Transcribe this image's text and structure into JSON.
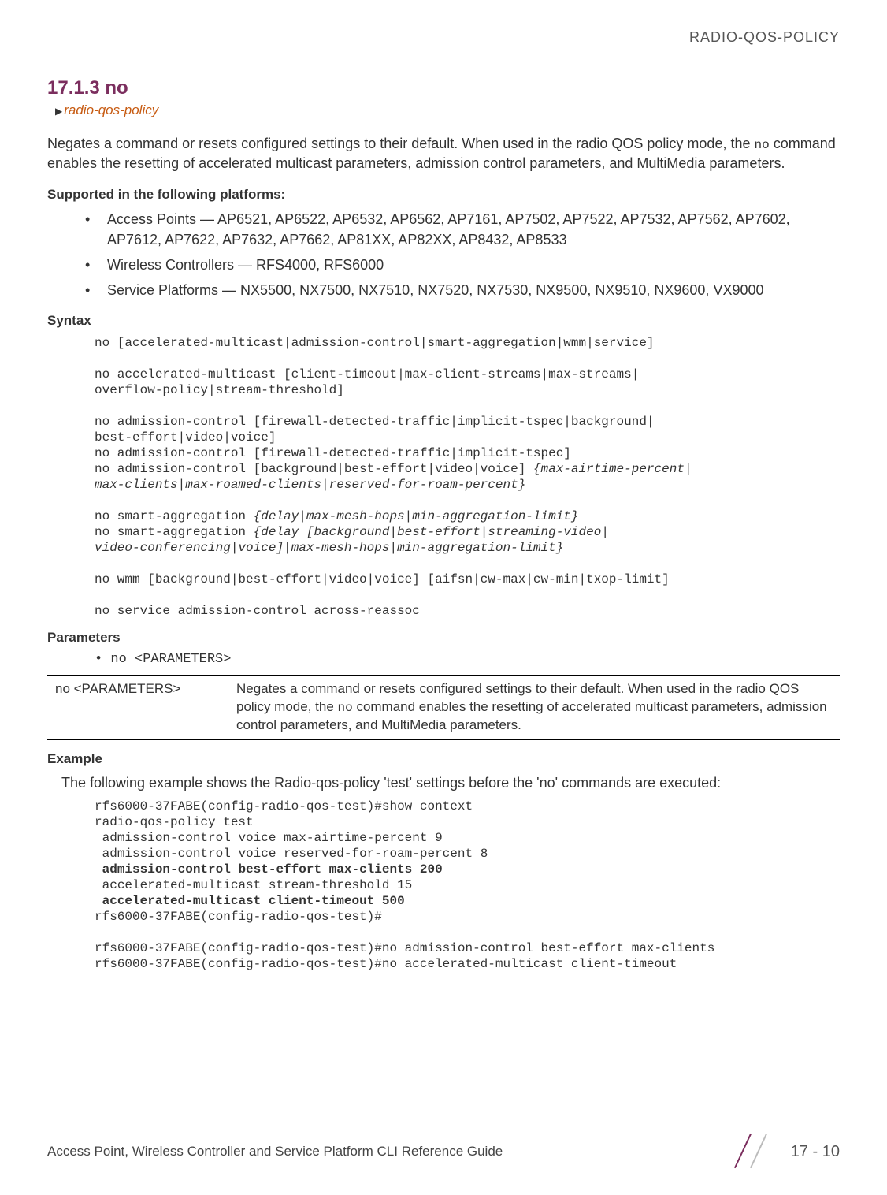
{
  "header": {
    "title": "RADIO-QOS-POLICY"
  },
  "section": {
    "number_title": "17.1.3 no",
    "breadcrumb": "radio-qos-policy"
  },
  "intro": {
    "part1": "Negates a command or resets configured settings to their default. When used in the radio QOS policy mode, the ",
    "mono": "no",
    "part2": " command enables the resetting of accelerated multicast parameters, admission control parameters, and MultiMedia parameters."
  },
  "platforms_label": "Supported in the following platforms:",
  "platforms": [
    "Access Points — AP6521, AP6522, AP6532, AP6562, AP7161, AP7502, AP7522, AP7532, AP7562, AP7602, AP7612, AP7622, AP7632, AP7662, AP81XX, AP82XX, AP8432, AP8533",
    "Wireless Controllers — RFS4000, RFS6000",
    "Service Platforms — NX5500, NX7500, NX7510, NX7520, NX7530, NX9500, NX9510, NX9600, VX9000"
  ],
  "syntax_label": "Syntax",
  "syntax": {
    "l1": "no [accelerated-multicast|admission-control|smart-aggregation|wmm|service]",
    "l2": "no accelerated-multicast [client-timeout|max-client-streams|max-streams|\noverflow-policy|stream-threshold]",
    "l3": "no admission-control [firewall-detected-traffic|implicit-tspec|background|\nbest-effort|video|voice]",
    "l4": "no admission-control [firewall-detected-traffic|implicit-tspec]",
    "l5a": "no admission-control [background|best-effort|video|voice] ",
    "l5b": "{max-airtime-percent|\nmax-clients|max-roamed-clients|reserved-for-roam-percent}",
    "l6a": "no smart-aggregation ",
    "l6b": "{delay|max-mesh-hops|min-aggregation-limit}",
    "l7a": "no smart-aggregation ",
    "l7b": "{delay [background|best-effort|streaming-video|\nvideo-conferencing|voice]|max-mesh-hops|min-aggregation-limit}",
    "l8": "no wmm [background|best-effort|video|voice] [aifsn|cw-max|cw-min|txop-limit]",
    "l9": "no service admission-control across-reassoc"
  },
  "parameters_label": "Parameters",
  "param_bullet": "• no <PARAMETERS>",
  "param_table": {
    "left": "no <PARAMETERS>",
    "right_a": "Negates a command or resets configured settings to their default. When used in the radio QOS policy mode, the ",
    "right_mono": "no",
    "right_b": " command enables the resetting of accelerated multicast parameters, admission control parameters, and MultiMedia parameters."
  },
  "example_label": "Example",
  "example_intro": "The following example shows the Radio-qos-policy 'test' settings before the 'no' commands are executed:",
  "example": {
    "l1": "rfs6000-37FABE(config-radio-qos-test)#show context",
    "l2": "radio-qos-policy test",
    "l3": " admission-control voice max-airtime-percent 9",
    "l4": " admission-control voice reserved-for-roam-percent 8",
    "l5": " admission-control best-effort max-clients 200",
    "l6": " accelerated-multicast stream-threshold 15",
    "l7": " accelerated-multicast client-timeout 500",
    "l8": "rfs6000-37FABE(config-radio-qos-test)#",
    "l9": "rfs6000-37FABE(config-radio-qos-test)#no admission-control best-effort max-clients",
    "l10": "rfs6000-37FABE(config-radio-qos-test)#no accelerated-multicast client-timeout"
  },
  "footer": {
    "left": "Access Point, Wireless Controller and Service Platform CLI Reference Guide",
    "page": "17 - 10"
  }
}
